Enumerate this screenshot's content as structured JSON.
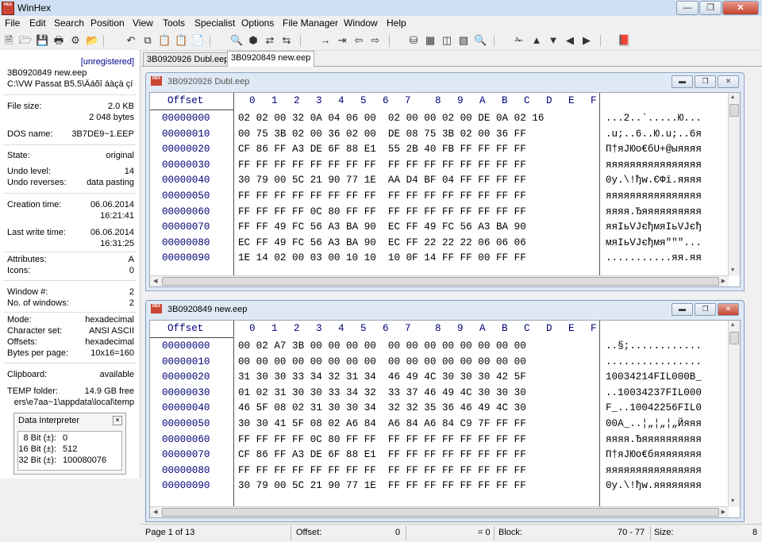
{
  "window": {
    "title": "WinHex",
    "logo_text": "HEX"
  },
  "menu": [
    "File",
    "Edit",
    "Search",
    "Position",
    "View",
    "Tools",
    "Specialist",
    "Options",
    "File Manager",
    "Window",
    "Help"
  ],
  "info": {
    "unregistered": "[unregistered]",
    "file_name": "3B0920849 new.eep",
    "file_path": "C:\\VW Passat B5.5\\Âáõî áàçà çí",
    "file_size_label": "File size:",
    "file_size_kb": "2.0 KB",
    "file_size_bytes": "2 048 bytes",
    "dos_name_label": "DOS name:",
    "dos_name": "3B7DE9~1.EEP",
    "state_label": "State:",
    "state": "original",
    "undo_level_label": "Undo level:",
    "undo_level": "14",
    "undo_reverses_label": "Undo reverses:",
    "undo_reverses": "data pasting",
    "creation_label": "Creation time:",
    "creation_date": "06.06.2014",
    "creation_time": "16:21:41",
    "lastwrite_label": "Last write time:",
    "lastwrite_date": "06.06.2014",
    "lastwrite_time": "16:31:25",
    "attributes_label": "Attributes:",
    "attributes": "A",
    "icons_label": "Icons:",
    "icons": "0",
    "window_no_label": "Window #:",
    "window_no": "2",
    "num_windows_label": "No. of windows:",
    "num_windows": "2",
    "mode_label": "Mode:",
    "mode": "hexadecimal",
    "charset_label": "Character set:",
    "charset": "ANSI ASCII",
    "offsets_label": "Offsets:",
    "offsets": "hexadecimal",
    "bpp_label": "Bytes per page:",
    "bpp": "10x16=160",
    "clipboard_label": "Clipboard:",
    "clipboard": "available",
    "temp_label": "TEMP folder:",
    "temp_free": "14.9 GB free",
    "temp_path": "ers\\e7aa~1\\appdata\\local\\temp"
  },
  "data_interpreter": {
    "title": "Data Interpreter",
    "rows": [
      {
        "k": "8 Bit (±):",
        "v": "0"
      },
      {
        "k": "16 Bit (±):",
        "v": "512"
      },
      {
        "k": "32 Bit (±):",
        "v": "100080076"
      }
    ]
  },
  "tabs": [
    "3B0920926 Dubl.eep",
    "3B0920849 new.eep"
  ],
  "hex_header": {
    "offset": "Offset",
    "cols": [
      "0",
      "1",
      "2",
      "3",
      "4",
      "5",
      "6",
      "7",
      "8",
      "9",
      "A",
      "B",
      "C",
      "D",
      "E",
      "F"
    ]
  },
  "editors": [
    {
      "title": "3B0920926 Dubl.eep",
      "rows": [
        {
          "off": "00000000",
          "hex": "02 02 00 32 0A 04 06 00  02 00 00 02 00 DE 0A 02 16",
          "asc": "...2..`.....Ю..."
        },
        {
          "off": "00000010",
          "hex": "00 75 3B 02 00 36 02 00  DE 08 75 3B 02 00 36 FF",
          "asc": ".u;..6..Ю.u;..6я"
        },
        {
          "off": "00000020",
          "hex": "CF 86 FF A3 DE 6F 88 E1  55 2B 40 FB FF FF FF FF",
          "asc": "П†яЈЮо€бU+@ыяяяя"
        },
        {
          "off": "00000030",
          "hex": "FF FF FF FF FF FF FF FF  FF FF FF FF FF FF FF FF",
          "asc": "яяяяяяяяяяяяяяяя"
        },
        {
          "off": "00000040",
          "hex": "30 79 00 5C 21 90 77 1E  AA D4 BF 04 FF FF FF FF",
          "asc": "0y.\\!ђw.ЄФї.яяяя"
        },
        {
          "off": "00000050",
          "hex": "FF FF FF FF FF FF FF FF  FF FF FF FF FF FF FF FF",
          "asc": "яяяяяяяяяяяяяяяя"
        },
        {
          "off": "00000060",
          "hex": "FF FF FF FF 0C 80 FF FF  FF FF FF FF FF FF FF FF",
          "asc": "яяяя.Ђяяяяяяяяяя"
        },
        {
          "off": "00000070",
          "hex": "FF FF 49 FC 56 A3 BA 90  EC FF 49 FC 56 A3 BA 90",
          "asc": "яяIьVЈєђмяIьVЈєђ"
        },
        {
          "off": "00000080",
          "hex": "EC FF 49 FC 56 A3 BA 90  EC FF 22 22 22 06 06 06",
          "asc": "мяIьVЈєђмя\"\"\"..."
        },
        {
          "off": "00000090",
          "hex": "1E 14 02 00 03 00 10 10  10 0F 14 FF FF 00 FF FF",
          "asc": "...........яя.яя"
        }
      ]
    },
    {
      "title": "3B0920849 new.eep",
      "rows": [
        {
          "off": "00000000",
          "hex": "00 02 A7 3B 00 00 00 00  00 00 00 00 00 00 00 00",
          "asc": "..§;............"
        },
        {
          "off": "00000010",
          "hex": "00 00 00 00 00 00 00 00  00 00 00 00 00 00 00 00",
          "asc": "................"
        },
        {
          "off": "00000020",
          "hex": "31 30 30 33 34 32 31 34  46 49 4C 30 30 30 42 5F",
          "asc": "10034214FIL000B_"
        },
        {
          "off": "00000030",
          "hex": "01 02 31 30 30 33 34 32  33 37 46 49 4C 30 30 30",
          "asc": "..10034237FIL000"
        },
        {
          "off": "00000040",
          "hex": "46 5F 08 02 31 30 30 34  32 32 35 36 46 49 4C 30",
          "asc": "F_..10042256FIL0"
        },
        {
          "off": "00000050",
          "hex": "30 30 41 5F 08 02 A6 84  A6 84 A6 84 C9 7F FF FF",
          "asc": "00A_..¦„¦„¦„Йяяя"
        },
        {
          "off": "00000060",
          "hex": "FF FF FF FF 0C 80 FF FF  FF FF FF FF FF FF FF FF",
          "asc": "яяяя.Ђяяяяяяяяяя"
        },
        {
          "off": "00000070",
          "hex": "CF 86 FF A3 DE 6F 88 E1  FF FF FF FF FF FF FF FF",
          "asc": "П†яЈЮо€бяяяяяяяя"
        },
        {
          "off": "00000080",
          "hex": "FF FF FF FF FF FF FF FF  FF FF FF FF FF FF FF FF",
          "asc": "яяяяяяяяяяяяяяяя"
        },
        {
          "off": "00000090",
          "hex": "30 79 00 5C 21 90 77 1E  FF FF FF FF FF FF FF FF",
          "asc": "0y.\\!ђw.яяяяяяяя"
        }
      ]
    }
  ],
  "status": {
    "page": "Page 1 of 13",
    "offset_label": "Offset:",
    "offset_value": "0",
    "equals": "= 0",
    "block_label": "Block:",
    "block_value": "70 - 77",
    "size_label": "Size:",
    "size_value": "8"
  }
}
